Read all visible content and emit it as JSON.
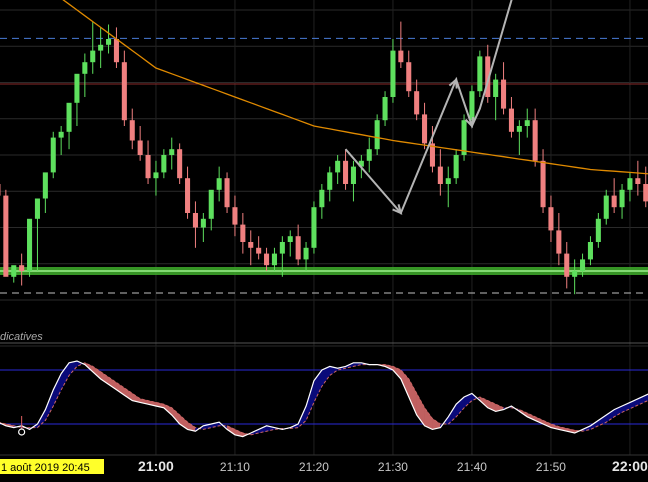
{
  "chart_data": {
    "type": "candlestick",
    "x_labels": [
      {
        "label": "21:00",
        "bar": 20,
        "major": true
      },
      {
        "label": "21:10",
        "bar": 30,
        "major": false
      },
      {
        "label": "21:20",
        "bar": 40,
        "major": false
      },
      {
        "label": "21:30",
        "bar": 50,
        "major": false
      },
      {
        "label": "21:40",
        "bar": 60,
        "major": false
      },
      {
        "label": "21:50",
        "bar": 70,
        "major": false
      },
      {
        "label": "22:00",
        "bar": 80,
        "major": true
      }
    ],
    "current_date_label": "1 août 2019 20:45",
    "indicator_pane_label": "dicatives",
    "price_pane": {
      "ylim": [
        0,
        100
      ],
      "horizontal_levels": [
        {
          "value": 90.2,
          "color": "#4a7bd6",
          "style": "dashed"
        },
        {
          "value": 74.5,
          "color": "#8a2a2a",
          "style": "solid"
        },
        {
          "value": 10.0,
          "color": "#3fae2c",
          "style": "band"
        },
        {
          "value": 2.4,
          "color": "#bfbfbf",
          "style": "dashed"
        }
      ],
      "moving_average_color": "#e08a00",
      "up_color": "#5ee05e",
      "down_color": "#f08080",
      "ohlc": [
        [
          40,
          43,
          38,
          36
        ],
        [
          36,
          38,
          10,
          8
        ],
        [
          8,
          9,
          6,
          12
        ],
        [
          12,
          16,
          5,
          10
        ],
        [
          10,
          12,
          8,
          28
        ],
        [
          28,
          30,
          10,
          35
        ],
        [
          35,
          40,
          30,
          44
        ],
        [
          44,
          58,
          42,
          56
        ],
        [
          56,
          60,
          50,
          58
        ],
        [
          58,
          62,
          52,
          68
        ],
        [
          68,
          72,
          60,
          78
        ],
        [
          78,
          85,
          70,
          82
        ],
        [
          82,
          96,
          78,
          86
        ],
        [
          86,
          94,
          80,
          88
        ],
        [
          88,
          95,
          85,
          90
        ],
        [
          90,
          94,
          80,
          82
        ],
        [
          82,
          86,
          60,
          62
        ],
        [
          62,
          66,
          52,
          55
        ],
        [
          55,
          60,
          48,
          50
        ],
        [
          50,
          55,
          40,
          42
        ],
        [
          42,
          48,
          36,
          44
        ],
        [
          44,
          52,
          42,
          50
        ],
        [
          50,
          56,
          45,
          52
        ],
        [
          52,
          54,
          40,
          42
        ],
        [
          42,
          46,
          28,
          30
        ],
        [
          30,
          34,
          18,
          25
        ],
        [
          25,
          30,
          20,
          28
        ],
        [
          28,
          34,
          24,
          38
        ],
        [
          38,
          46,
          34,
          42
        ],
        [
          42,
          44,
          30,
          32
        ],
        [
          32,
          36,
          22,
          26
        ],
        [
          26,
          30,
          16,
          20
        ],
        [
          20,
          24,
          12,
          18
        ],
        [
          18,
          22,
          14,
          16
        ],
        [
          16,
          18,
          10,
          12
        ],
        [
          12,
          18,
          10,
          16
        ],
        [
          16,
          22,
          8,
          20
        ],
        [
          20,
          24,
          15,
          22
        ],
        [
          22,
          26,
          12,
          14
        ],
        [
          14,
          20,
          10,
          18
        ],
        [
          18,
          34,
          16,
          32
        ],
        [
          32,
          40,
          28,
          38
        ],
        [
          38,
          46,
          34,
          44
        ],
        [
          44,
          50,
          40,
          48
        ],
        [
          48,
          52,
          38,
          40
        ],
        [
          40,
          48,
          34,
          46
        ],
        [
          46,
          50,
          42,
          48
        ],
        [
          48,
          56,
          44,
          52
        ],
        [
          52,
          64,
          50,
          62
        ],
        [
          62,
          72,
          60,
          70
        ],
        [
          70,
          90,
          68,
          86
        ],
        [
          86,
          96,
          80,
          82
        ],
        [
          82,
          86,
          70,
          72
        ],
        [
          72,
          76,
          62,
          64
        ],
        [
          64,
          68,
          52,
          54
        ],
        [
          54,
          60,
          44,
          46
        ],
        [
          46,
          52,
          36,
          40
        ],
        [
          40,
          46,
          32,
          42
        ],
        [
          42,
          52,
          40,
          50
        ],
        [
          50,
          64,
          48,
          62
        ],
        [
          62,
          74,
          60,
          72
        ],
        [
          72,
          86,
          70,
          84
        ],
        [
          84,
          88,
          68,
          70
        ],
        [
          70,
          78,
          62,
          76
        ],
        [
          76,
          82,
          64,
          66
        ],
        [
          66,
          70,
          56,
          58
        ],
        [
          58,
          62,
          50,
          60
        ],
        [
          60,
          66,
          56,
          62
        ],
        [
          62,
          66,
          46,
          48
        ],
        [
          48,
          52,
          30,
          32
        ],
        [
          32,
          36,
          20,
          24
        ],
        [
          24,
          30,
          12,
          16
        ],
        [
          16,
          20,
          4,
          8
        ],
        [
          8,
          14,
          2,
          10
        ],
        [
          10,
          16,
          8,
          14
        ],
        [
          14,
          22,
          12,
          20
        ],
        [
          20,
          30,
          18,
          28
        ],
        [
          28,
          38,
          26,
          36
        ],
        [
          36,
          42,
          30,
          32
        ],
        [
          32,
          40,
          28,
          38
        ],
        [
          38,
          44,
          34,
          42
        ],
        [
          42,
          48,
          36,
          40
        ],
        [
          40,
          46,
          32,
          34
        ],
        [
          34,
          42,
          30,
          40
        ],
        [
          40,
          48,
          38,
          46
        ],
        [
          46,
          52,
          42,
          50
        ]
      ],
      "moving_average": [
        120,
        118,
        116,
        114,
        112,
        110,
        108,
        106,
        104,
        102,
        100,
        98,
        96,
        94,
        92,
        90,
        88,
        86,
        84,
        82,
        80,
        79,
        78,
        77,
        76,
        75,
        74,
        73,
        72,
        71,
        70,
        69,
        68,
        67,
        66,
        65,
        64,
        63,
        62,
        61,
        60,
        59.5,
        59,
        58.5,
        58,
        57.5,
        57,
        56.5,
        56,
        55.5,
        55,
        54.6,
        54.2,
        53.8,
        53.4,
        53,
        52.6,
        52.2,
        51.8,
        51.4,
        51,
        50.6,
        50.2,
        49.8,
        49.4,
        49,
        48.6,
        48.2,
        47.8,
        47.4,
        47,
        46.6,
        46.2,
        45.8,
        45.4,
        45,
        44.8,
        44.6,
        44.4,
        44.2,
        44,
        43.8,
        43.6,
        43.4,
        43.2,
        43
      ],
      "drawn_path": [
        {
          "bar": 44,
          "value": 52
        },
        {
          "bar": 51,
          "value": 30
        },
        {
          "bar": 58,
          "value": 76
        },
        {
          "bar": 60,
          "value": 60
        },
        {
          "bar": 61,
          "value": 66
        },
        {
          "bar": 67,
          "value": 122
        }
      ]
    },
    "indicator_pane": {
      "ylim": [
        0,
        100
      ],
      "levels": [
        {
          "value": 80,
          "color": "#2a2ad8"
        },
        {
          "value": 20,
          "color": "#2a2ad8"
        }
      ],
      "fast_line_color": "#ffffff",
      "slow_line_color": "#cc6666",
      "fill_up_color": "#0a0a7a",
      "fill_down_color": "#c06060",
      "fast": [
        22,
        18,
        16,
        18,
        14,
        20,
        36,
        58,
        76,
        88,
        90,
        86,
        78,
        70,
        64,
        58,
        52,
        46,
        44,
        42,
        40,
        38,
        30,
        20,
        14,
        12,
        18,
        20,
        22,
        14,
        8,
        6,
        10,
        14,
        18,
        16,
        14,
        16,
        20,
        40,
        68,
        80,
        84,
        82,
        84,
        88,
        88,
        86,
        86,
        84,
        80,
        70,
        50,
        30,
        18,
        14,
        16,
        28,
        42,
        50,
        54,
        46,
        38,
        34,
        36,
        40,
        34,
        28,
        24,
        20,
        16,
        14,
        12,
        10,
        14,
        18,
        24,
        30,
        36,
        40,
        44,
        48,
        52,
        56,
        58,
        60
      ],
      "slow": [
        22,
        20,
        18,
        16,
        16,
        16,
        24,
        40,
        58,
        74,
        84,
        88,
        84,
        78,
        72,
        66,
        60,
        54,
        48,
        46,
        44,
        42,
        38,
        30,
        22,
        16,
        14,
        16,
        18,
        18,
        14,
        10,
        8,
        10,
        12,
        14,
        15,
        15,
        16,
        24,
        44,
        62,
        74,
        80,
        82,
        84,
        86,
        86,
        86,
        86,
        84,
        80,
        70,
        54,
        38,
        26,
        20,
        20,
        28,
        38,
        46,
        50,
        46,
        42,
        38,
        38,
        36,
        32,
        28,
        24,
        20,
        17,
        15,
        13,
        12,
        14,
        18,
        22,
        28,
        33,
        37,
        41,
        45,
        49,
        53,
        56
      ],
      "marker": {
        "bar": 3,
        "value": 20
      }
    }
  }
}
